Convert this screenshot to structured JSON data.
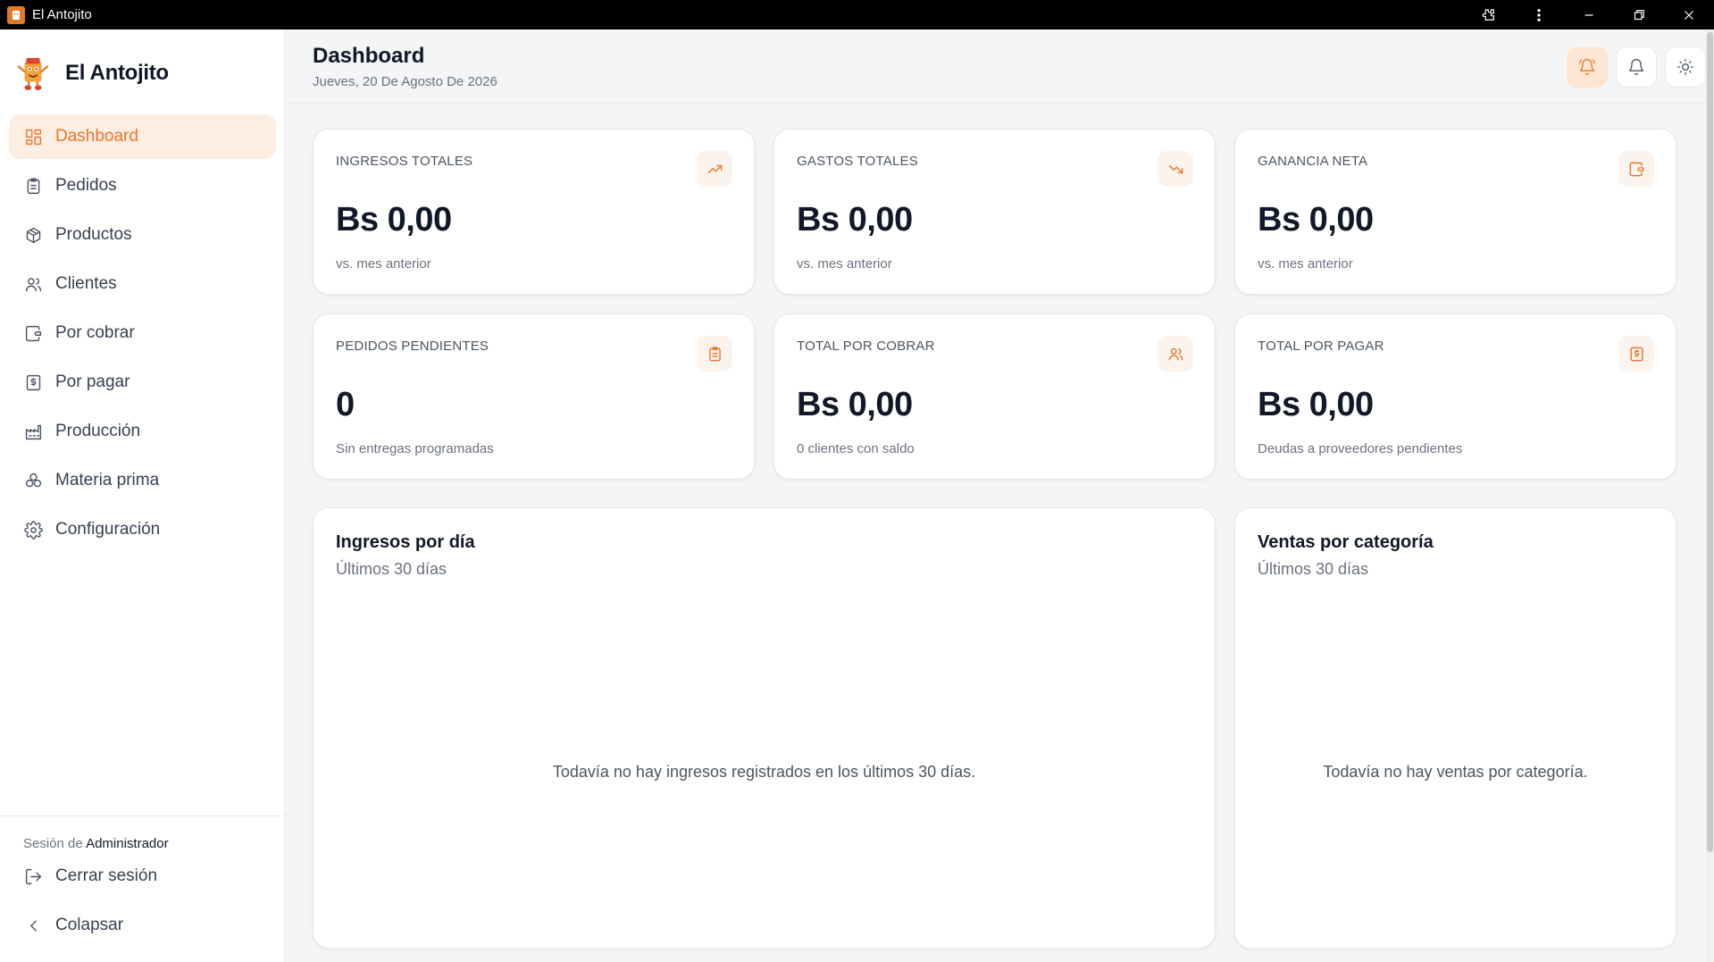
{
  "window": {
    "title": "El Antojito"
  },
  "sidebar": {
    "brand": "El Antojito",
    "items": [
      {
        "label": "Dashboard",
        "icon": "dashboard-icon",
        "active": true
      },
      {
        "label": "Pedidos",
        "icon": "clipboard-icon"
      },
      {
        "label": "Productos",
        "icon": "package-icon"
      },
      {
        "label": "Clientes",
        "icon": "users-icon"
      },
      {
        "label": "Por cobrar",
        "icon": "wallet-icon"
      },
      {
        "label": "Por pagar",
        "icon": "receipt-icon"
      },
      {
        "label": "Producción",
        "icon": "factory-icon"
      },
      {
        "label": "Materia prima",
        "icon": "ingredients-icon"
      },
      {
        "label": "Configuración",
        "icon": "gear-icon"
      }
    ],
    "session_prefix": "Sesión de",
    "session_user": "Administrador",
    "logout": "Cerrar sesión",
    "collapse": "Colapsar"
  },
  "header": {
    "title": "Dashboard",
    "date": "Jueves, 20 De Agosto De 2026"
  },
  "stats": [
    {
      "label": "INGRESOS TOTALES",
      "value": "Bs 0,00",
      "sub": "vs. mes anterior",
      "icon": "trending-up-icon"
    },
    {
      "label": "GASTOS TOTALES",
      "value": "Bs 0,00",
      "sub": "vs. mes anterior",
      "icon": "trending-down-icon"
    },
    {
      "label": "GANANCIA NETA",
      "value": "Bs 0,00",
      "sub": "vs. mes anterior",
      "icon": "wallet-icon"
    },
    {
      "label": "PEDIDOS PENDIENTES",
      "value": "0",
      "sub": "Sin entregas programadas",
      "icon": "clipboard-icon"
    },
    {
      "label": "TOTAL POR COBRAR",
      "value": "Bs 0,00",
      "sub": "0 clientes con saldo",
      "icon": "users-icon"
    },
    {
      "label": "TOTAL POR PAGAR",
      "value": "Bs 0,00",
      "sub": "Deudas a proveedores pendientes",
      "icon": "receipt-icon"
    }
  ],
  "charts": {
    "income": {
      "title": "Ingresos por día",
      "subtitle": "Últimos 30 días",
      "empty": "Todavía no hay ingresos registrados en los últimos 30 días."
    },
    "categories": {
      "title": "Ventas por categoría",
      "subtitle": "Últimos 30 días",
      "empty": "Todavía no hay ventas por categoría."
    }
  },
  "colors": {
    "accent": "#e8772e",
    "accent_bg": "#fdeee1",
    "background": "#f4f5f7"
  }
}
